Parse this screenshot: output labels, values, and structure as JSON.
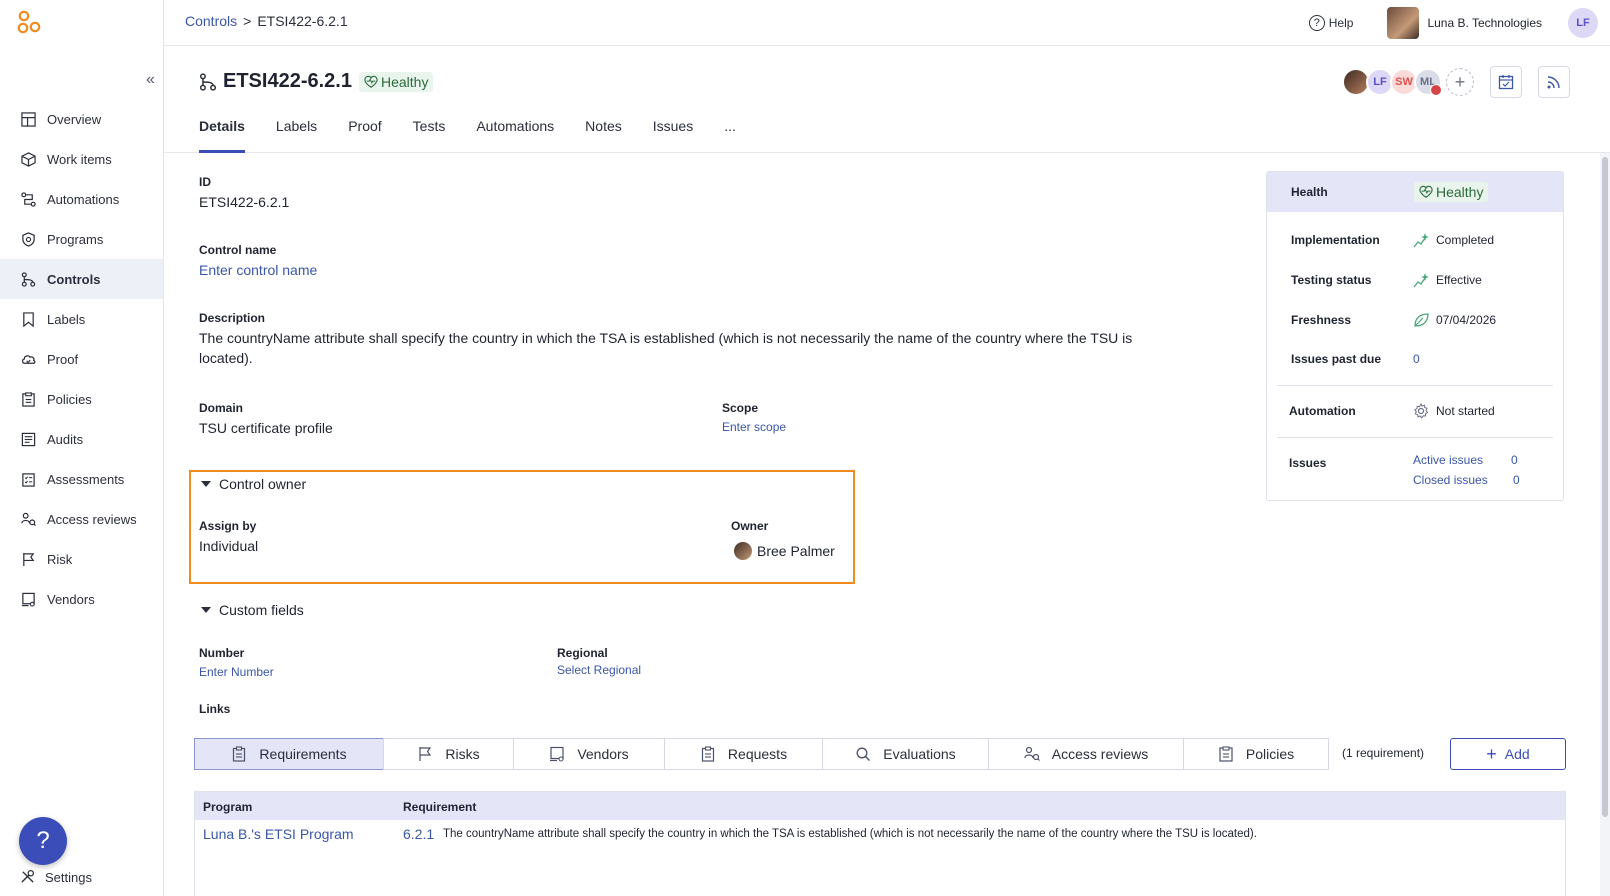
{
  "breadcrumb": {
    "parent": "Controls",
    "separator": ">",
    "current": "ETSI422-6.2.1"
  },
  "topbar": {
    "help": "Help",
    "org_name": "Luna B. Technologies",
    "user_initials": "LF"
  },
  "sidebar": {
    "items": [
      {
        "label": "Overview",
        "icon": "overview-icon"
      },
      {
        "label": "Work items",
        "icon": "work-items-icon"
      },
      {
        "label": "Automations",
        "icon": "automations-icon"
      },
      {
        "label": "Programs",
        "icon": "programs-icon"
      },
      {
        "label": "Controls",
        "icon": "controls-icon",
        "active": true
      },
      {
        "label": "Labels",
        "icon": "labels-icon"
      },
      {
        "label": "Proof",
        "icon": "proof-icon"
      },
      {
        "label": "Policies",
        "icon": "policies-icon"
      },
      {
        "label": "Audits",
        "icon": "audits-icon"
      },
      {
        "label": "Assessments",
        "icon": "assessments-icon"
      },
      {
        "label": "Access reviews",
        "icon": "access-reviews-icon"
      },
      {
        "label": "Risk",
        "icon": "risk-icon"
      },
      {
        "label": "Vendors",
        "icon": "vendors-icon"
      }
    ],
    "help_fab": "?",
    "settings": "Settings"
  },
  "header": {
    "title": "ETSI422-6.2.1",
    "status": "Healthy",
    "tabs": [
      "Details",
      "Labels",
      "Proof",
      "Tests",
      "Automations",
      "Notes",
      "Issues",
      "..."
    ],
    "avatars": [
      "",
      "LF",
      "SW",
      "ML"
    ]
  },
  "details": {
    "id_label": "ID",
    "id_value": "ETSI422-6.2.1",
    "control_name_label": "Control name",
    "control_name_placeholder": "Enter control name",
    "description_label": "Description",
    "description_line1": "The countryName attribute shall specify the country in which the TSA is established (which is not necessarily the name of the country where the TSU is",
    "description_line2": "located).",
    "domain_label": "Domain",
    "domain_value": "TSU certificate profile",
    "scope_label": "Scope",
    "scope_placeholder": "Enter scope"
  },
  "control_owner": {
    "title": "Control owner",
    "assign_by_label": "Assign by",
    "assign_by_value": "Individual",
    "owner_label": "Owner",
    "owner_value": "Bree Palmer"
  },
  "custom_fields": {
    "title": "Custom fields",
    "number_label": "Number",
    "number_placeholder": "Enter Number",
    "regional_label": "Regional",
    "regional_placeholder": "Select Regional"
  },
  "health": {
    "title": "Health",
    "status": "Healthy",
    "implementation_label": "Implementation",
    "implementation_value": "Completed",
    "testing_label": "Testing status",
    "testing_value": "Effective",
    "freshness_label": "Freshness",
    "freshness_value": "07/04/2026",
    "issues_past_due_label": "Issues past due",
    "issues_past_due_value": "0",
    "automation_label": "Automation",
    "automation_value": "Not started",
    "issues_label": "Issues",
    "active_issues_label": "Active issues",
    "active_issues_value": "0",
    "closed_issues_label": "Closed issues",
    "closed_issues_value": "0"
  },
  "links": {
    "title": "Links",
    "tabs": [
      "Requirements",
      "Risks",
      "Vendors",
      "Requests",
      "Evaluations",
      "Access reviews",
      "Policies"
    ],
    "count": "(1 requirement)",
    "add": "Add",
    "table": {
      "col_program": "Program",
      "col_requirement": "Requirement",
      "rows": [
        {
          "program": "Luna B.'s ETSI Program",
          "req_number": "6.2.1",
          "req_text": "The countryName attribute shall specify the country in which the TSA is established (which is not necessarily the name of the country where the TSU is located)."
        }
      ]
    }
  }
}
